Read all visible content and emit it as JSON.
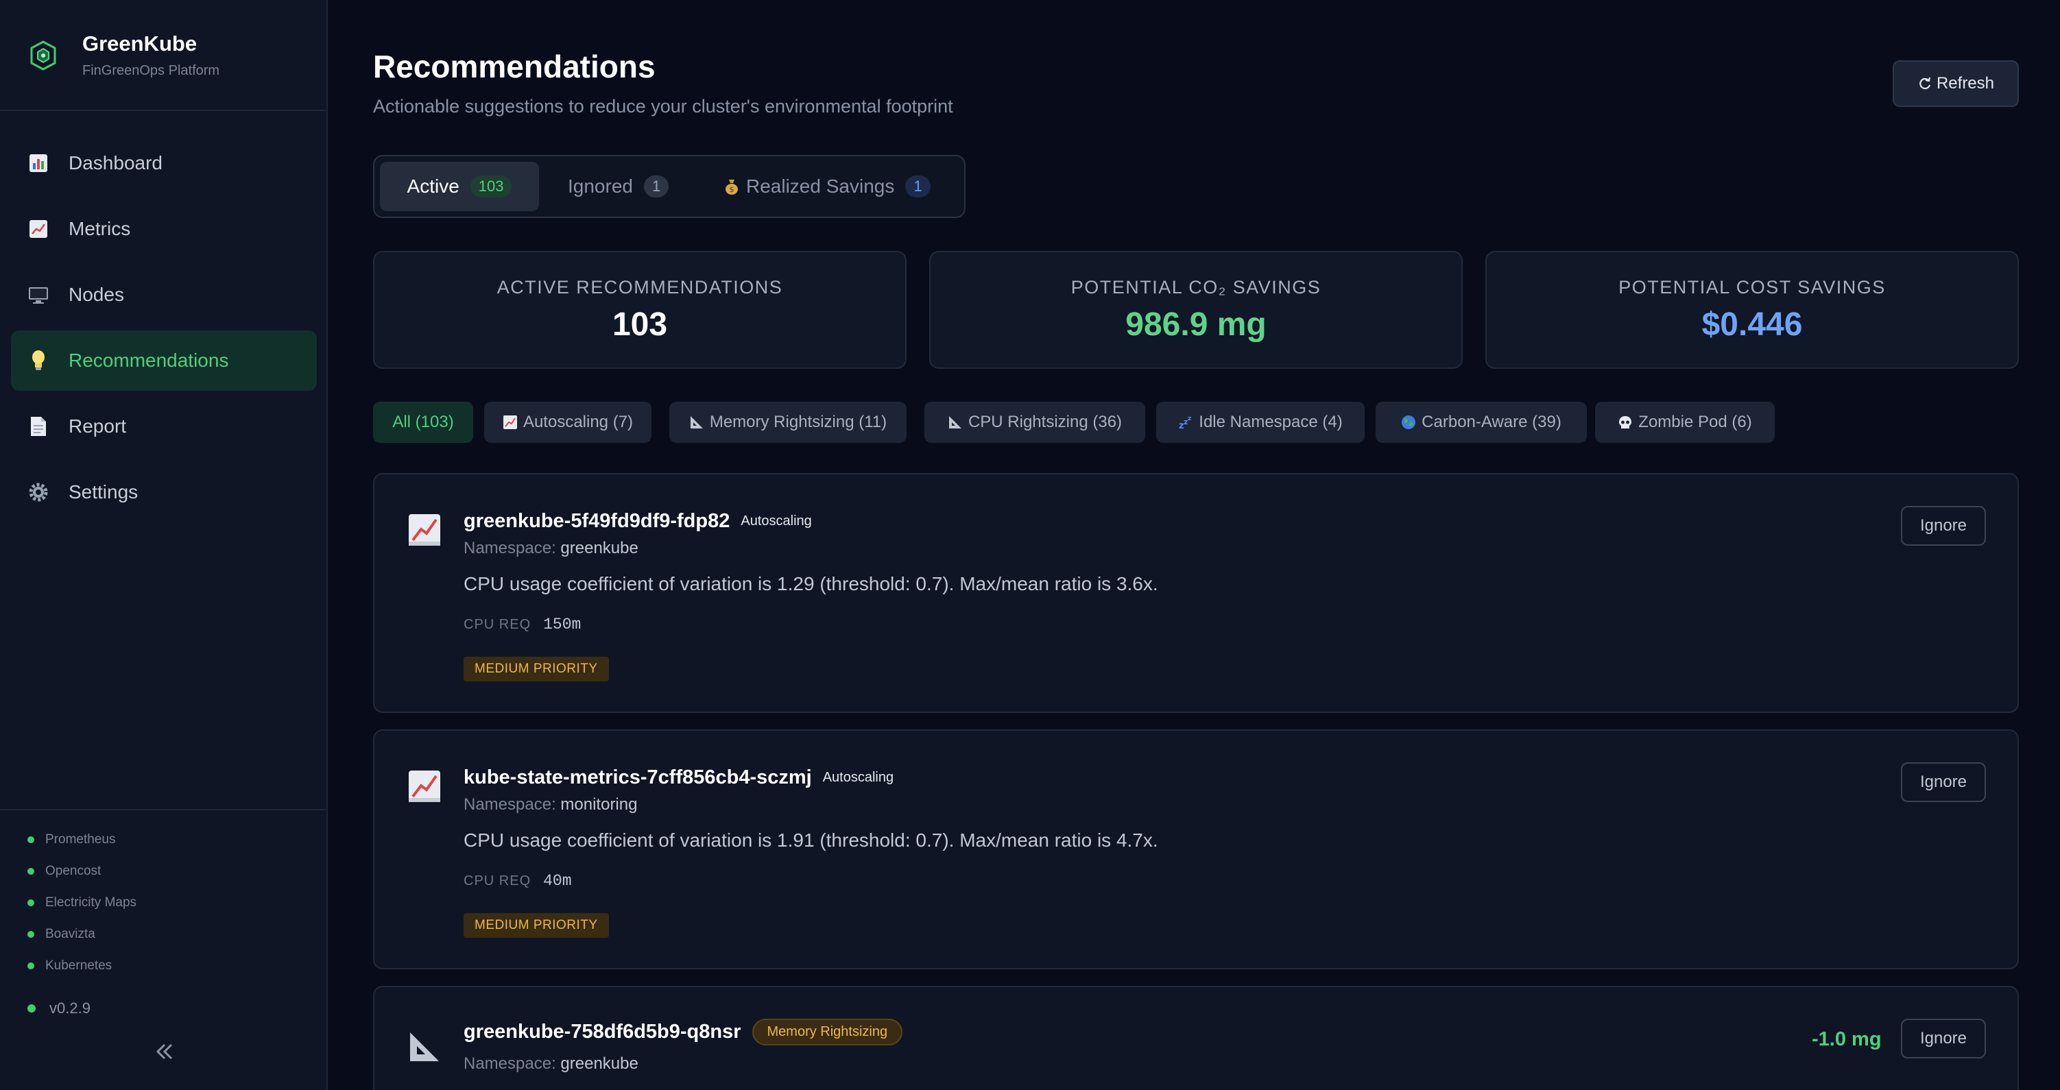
{
  "brand": {
    "name": "GreenKube",
    "subtitle": "FinGreenOps Platform"
  },
  "sidebar": {
    "items": [
      {
        "label": "Dashboard",
        "icon": "bar-chart-icon"
      },
      {
        "label": "Metrics",
        "icon": "trend-chart-icon"
      },
      {
        "label": "Nodes",
        "icon": "monitor-icon"
      },
      {
        "label": "Recommendations",
        "icon": "lightbulb-icon",
        "active": true
      },
      {
        "label": "Report",
        "icon": "document-icon"
      },
      {
        "label": "Settings",
        "icon": "gear-icon"
      }
    ],
    "integrations": [
      "Prometheus",
      "Opencost",
      "Electricity Maps",
      "Boavizta",
      "Kubernetes"
    ],
    "version": "v0.2.9"
  },
  "header": {
    "title": "Recommendations",
    "subtitle": "Actionable suggestions to reduce your cluster's environmental footprint",
    "refresh_label": "Refresh"
  },
  "tabs": [
    {
      "label": "Active",
      "count": "103",
      "active": true
    },
    {
      "label": "Ignored",
      "count": "1"
    },
    {
      "label": "Realized Savings",
      "count": "1",
      "icon": "money-bag-icon"
    }
  ],
  "stats": [
    {
      "label": "ACTIVE RECOMMENDATIONS",
      "value": "103",
      "color": "#ffffff"
    },
    {
      "label": "POTENTIAL CO₂ SAVINGS",
      "value": "986.9 mg",
      "color": "#5fd38a"
    },
    {
      "label": "POTENTIAL COST SAVINGS",
      "value": "$0.446",
      "color": "#6ea4f5"
    }
  ],
  "filters": [
    {
      "label": "All (103)",
      "active": true
    },
    {
      "label": "Autoscaling (7)",
      "icon": "chart-up-icon"
    },
    {
      "label": "Memory Rightsizing (11)",
      "icon": "triangle-ruler-icon"
    },
    {
      "label": "CPU Rightsizing (36)",
      "icon": "triangle-ruler-icon"
    },
    {
      "label": "Idle Namespace (4)",
      "icon": "sleep-icon"
    },
    {
      "label": "Carbon-Aware (39)",
      "icon": "globe-icon"
    },
    {
      "label": "Zombie Pod (6)",
      "icon": "skull-icon"
    }
  ],
  "cards": [
    {
      "name": "greenkube-5f49fd9df9-fdp82",
      "type": "Autoscaling",
      "namespace_label": "Namespace:",
      "namespace": "greenkube",
      "description": "CPU usage coefficient of variation is 1.29 (threshold: 0.7). Max/mean ratio is 3.6x.",
      "req_label": "CPU REQ",
      "req_value": "150m",
      "priority": "MEDIUM PRIORITY",
      "action": "Ignore"
    },
    {
      "name": "kube-state-metrics-7cff856cb4-sczmj",
      "type": "Autoscaling",
      "namespace_label": "Namespace:",
      "namespace": "monitoring",
      "description": "CPU usage coefficient of variation is 1.91 (threshold: 0.7). Max/mean ratio is 4.7x.",
      "req_label": "CPU REQ",
      "req_value": "40m",
      "priority": "MEDIUM PRIORITY",
      "action": "Ignore"
    },
    {
      "name": "greenkube-758df6d5b9-q8nsr",
      "type": "Memory Rightsizing",
      "namespace_label": "Namespace:",
      "namespace": "greenkube",
      "savings": "-1.0 mg",
      "action": "Ignore"
    }
  ],
  "colors": {
    "accent_green": "#4ed07c",
    "accent_blue": "#6ea4f5",
    "warning": "#f0b648",
    "background": "#080c1a"
  }
}
